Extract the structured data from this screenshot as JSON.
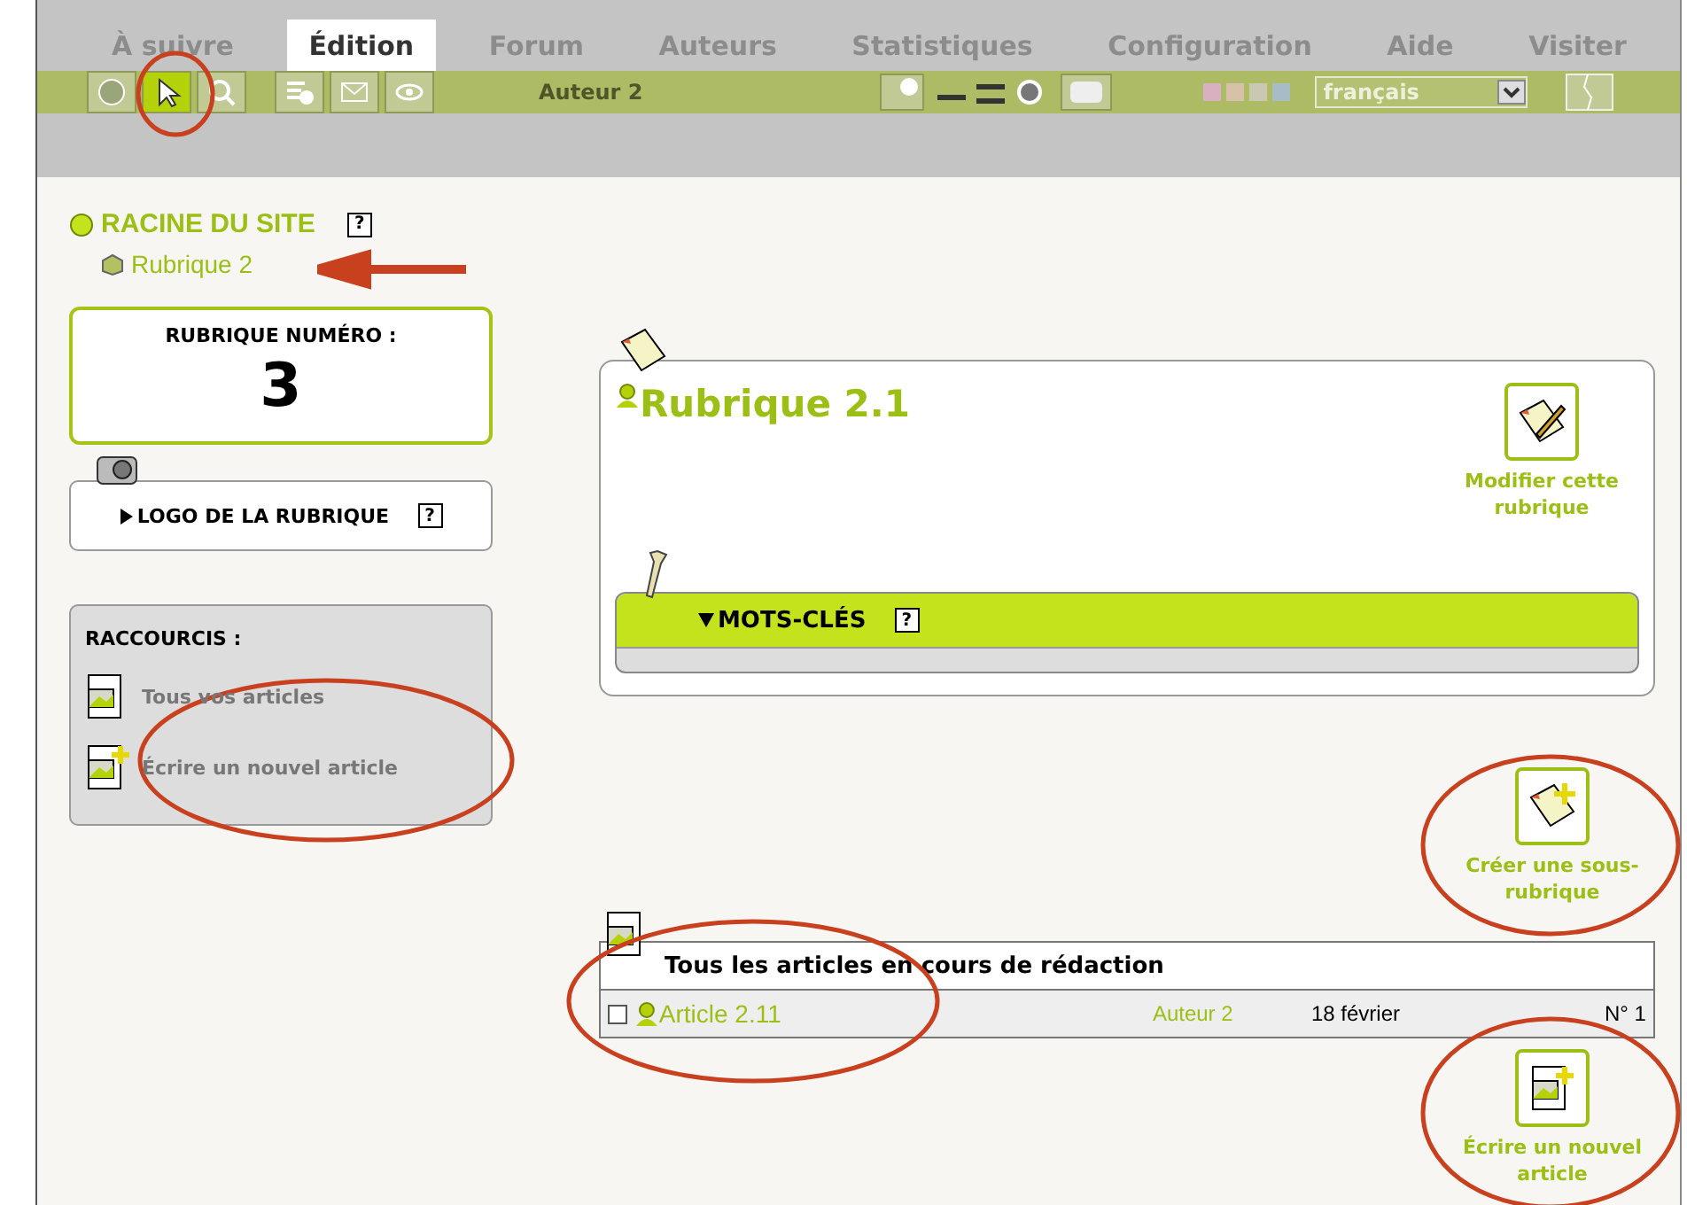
{
  "tabs": [
    {
      "label": "À suivre",
      "selected": false
    },
    {
      "label": "Édition",
      "selected": true
    },
    {
      "label": "Forum",
      "selected": false
    },
    {
      "label": "Auteurs",
      "selected": false
    },
    {
      "label": "Statistiques",
      "selected": false
    },
    {
      "label": "Configuration",
      "selected": false
    },
    {
      "label": "Aide",
      "selected": false
    },
    {
      "label": "Visiter",
      "selected": false
    }
  ],
  "toolbar": {
    "tools": [
      {
        "kind": "globe",
        "selected": false
      },
      {
        "kind": "pointer",
        "selected": true
      },
      {
        "kind": "search",
        "selected": false
      },
      {
        "kind": "calendar",
        "selected": false
      },
      {
        "kind": "mail",
        "selected": false
      },
      {
        "kind": "eye",
        "selected": false
      }
    ],
    "author": "Auteur 2",
    "language": "français"
  },
  "breadcrumb": {
    "root": "RACINE DU SITE",
    "help": "?",
    "child": "Rubrique 2"
  },
  "number_card": {
    "label": "RUBRIQUE NUMÉRO :",
    "number": "3"
  },
  "logo_card": {
    "label": "LOGO DE LA RUBRIQUE",
    "help": "?",
    "expanded": false
  },
  "shortcuts": {
    "title": "RACCOURCIS :",
    "items": [
      "Tous vos articles",
      "Écrire un nouvel article"
    ]
  },
  "section": {
    "title": "Rubrique 2.1",
    "edit_button": "Modifier cette rubrique",
    "keywords": {
      "label": "MOTS-CLÉS",
      "help": "?",
      "expanded": true
    }
  },
  "create_button": "Créer une sous-rubrique",
  "articles": {
    "title": "Tous les articles en cours de rédaction",
    "rows": [
      {
        "checked": false,
        "title": "Article 2.11",
        "author": "Auteur 2",
        "date": "18 février",
        "number": "N° 1"
      }
    ]
  },
  "write_button": "Écrire un nouvel article"
}
